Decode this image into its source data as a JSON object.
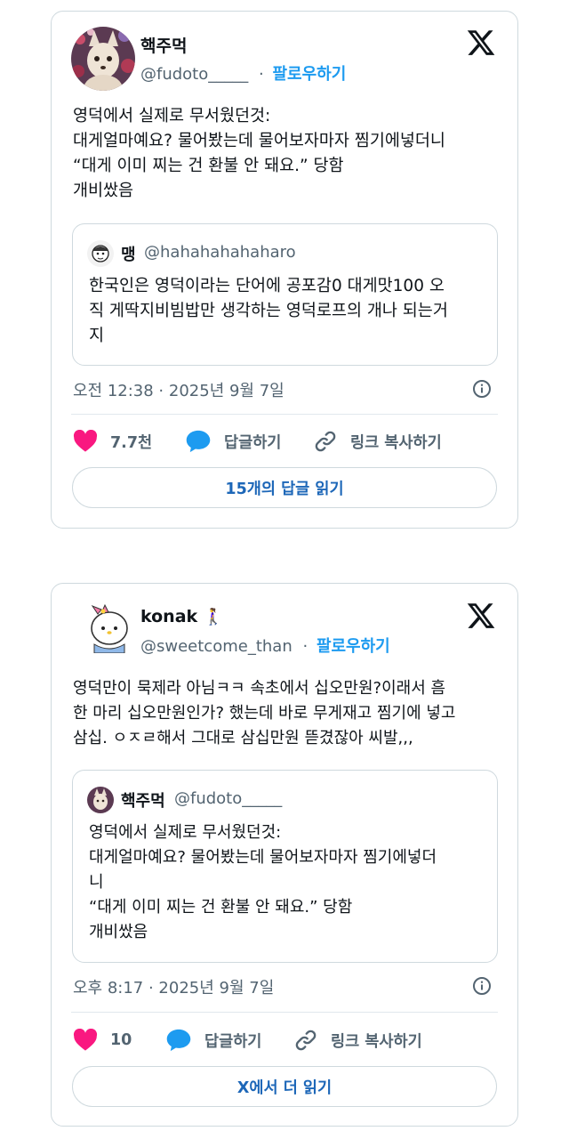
{
  "tweets": [
    {
      "author_name": "핵주먹",
      "handle": "@fudoto_____",
      "separator": "·",
      "follow_label": "팔로우하기",
      "text": "영덕에서 실제로 무서웠던것:\n대게얼마예요? 물어봤는데 물어보자마자 찜기에넣더니\n“대게 이미 찌는 건 환불 안 돼요.” 당함\n개비쌌음",
      "quote": {
        "author_name": "맹",
        "handle": "@hahahahahaharo",
        "text": "한국인은 영덕이라는 단어에 공포감0 대게맛100 오\n직 게딱지비빔밥만 생각하는 영덕로프의 개나 되는거\n지"
      },
      "timestamp": "오전 12:38 · 2025년 9월 7일",
      "like_count": "7.7천",
      "reply_label": "답글하기",
      "copy_link_label": "링크 복사하기",
      "read_replies_label": "15개의 답글 읽기"
    },
    {
      "author_name": "konak",
      "author_emoji": "🚶‍♀️",
      "handle": "@sweetcome_than",
      "separator": "·",
      "follow_label": "팔로우하기",
      "text": "영덕만이 묵제라 아님ㅋㅋ 속초에서 십오만원?이래서 흠\n한 마리 십오만원인가? 했는데 바로 무게재고 찜기에 넣고\n삼십. ㅇㅈㄹ해서 그대로 삼십만원 뜯겼잖아 씨발,,,",
      "quote": {
        "author_name": "핵주먹",
        "handle": "@fudoto_____",
        "text": "영덕에서 실제로 무서웠던것:\n대게얼마예요? 물어봤는데 물어보자마자 찜기에넣더\n니\n“대게 이미 찌는 건 환불 안 돼요.” 당함\n개비쌌음"
      },
      "timestamp": "오후 8:17 · 2025년 9월 7일",
      "like_count": "10",
      "reply_label": "답글하기",
      "copy_link_label": "링크 복사하기",
      "read_more_label": "X에서 더 읽기"
    }
  ],
  "colors": {
    "accent": "#1d9bf0",
    "like": "#f91880",
    "muted": "#536471",
    "border": "#cfd9de"
  },
  "icons": [
    "x-logo-icon",
    "info-icon",
    "heart-icon",
    "reply-bubble-icon",
    "link-icon"
  ]
}
